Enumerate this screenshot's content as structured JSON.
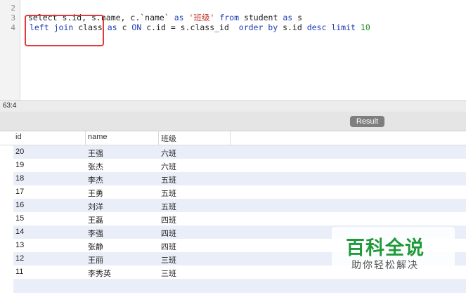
{
  "editor": {
    "line_numbers": [
      "2",
      "3",
      "4"
    ],
    "line3": {
      "t1": "select s.id, s.name, c.`name` ",
      "t2": "as",
      "t3": " ",
      "t4": "'班级'",
      "t5": " ",
      "t6": "from",
      "t7": " student ",
      "t8": "as",
      "t9": " s"
    },
    "line4": {
      "t1": "left join",
      "t2": " class ",
      "t3": "as",
      "t4": " c ",
      "t5": "ON",
      "t6": " c.id = s.class_id  ",
      "t7": "order by",
      "t8": " s.id ",
      "t9": "desc limit",
      "t10": " ",
      "t11": "10"
    }
  },
  "status": {
    "cursor_position": "63:4"
  },
  "result_tab": {
    "label": "Result"
  },
  "table": {
    "columns": [
      "id",
      "name",
      "班级"
    ],
    "rows": [
      [
        "20",
        "王强",
        "六班"
      ],
      [
        "19",
        "张杰",
        "六班"
      ],
      [
        "18",
        "李杰",
        "五班"
      ],
      [
        "17",
        "王勇",
        "五班"
      ],
      [
        "16",
        "刘洋",
        "五班"
      ],
      [
        "15",
        "王磊",
        "四班"
      ],
      [
        "14",
        "李强",
        "四班"
      ],
      [
        "13",
        "张静",
        "四班"
      ],
      [
        "12",
        "王丽",
        "三班"
      ],
      [
        "11",
        "李秀英",
        "三班"
      ]
    ]
  },
  "watermark": {
    "title": "百科全说",
    "subtitle": "助你轻松解决"
  },
  "colors": {
    "highlight": "#e23a3a",
    "keyword": "#1d3eb6",
    "string": "#c0392b",
    "number": "#1a8a1a",
    "row_alt": "#e9eef8"
  }
}
